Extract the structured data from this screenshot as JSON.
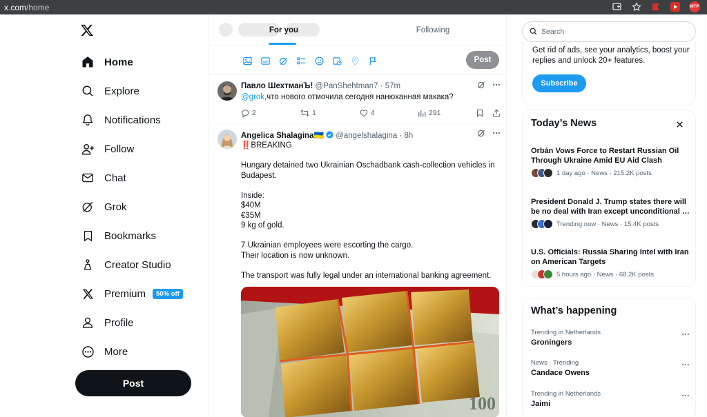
{
  "browser": {
    "url_host": "x.com",
    "url_path": "/home",
    "extension_1_label": "",
    "extension_2_label": "MTP"
  },
  "nav": {
    "items": [
      {
        "label": "Home",
        "icon": "home-icon"
      },
      {
        "label": "Explore",
        "icon": "search-icon"
      },
      {
        "label": "Notifications",
        "icon": "bell-icon"
      },
      {
        "label": "Follow",
        "icon": "follow-icon"
      },
      {
        "label": "Chat",
        "icon": "mail-icon"
      },
      {
        "label": "Grok",
        "icon": "grok-icon"
      },
      {
        "label": "Bookmarks",
        "icon": "bookmark-icon"
      },
      {
        "label": "Creator Studio",
        "icon": "creator-studio-icon"
      },
      {
        "label": "Premium",
        "icon": "x-logo-icon",
        "badge": "50% off"
      },
      {
        "label": "Profile",
        "icon": "profile-icon"
      },
      {
        "label": "More",
        "icon": "more-circle-icon"
      }
    ],
    "post_label": "Post"
  },
  "timeline": {
    "tabs": [
      "For you",
      "Following"
    ],
    "composer_post_label": "Post"
  },
  "tweet1": {
    "name": "Павло ШехтманЪ!",
    "handle": "@PanShehtman7",
    "time": "· 57m",
    "mention": "@grok",
    "text": ",что нового отмочила сегодня нанюханная макака?",
    "replies": "2",
    "reposts": "1",
    "likes": "4",
    "views": "291"
  },
  "tweet2": {
    "name": "Angelica Shalagina🇺🇦",
    "handle": "@angelshalagina",
    "time": "· 8h",
    "line1": "‼️BREAKING",
    "line2": "Hungary detained two Ukrainian Oschadbank cash-collection vehicles in",
    "line3": "Budapest.",
    "inside_label": "Inside:",
    "inside_1": "$40M",
    "inside_2": "€35M",
    "inside_3": "9 kg of gold.",
    "line4": "7 Ukrainian employees were escorting the cargo.",
    "line5": "Their location is now unknown.",
    "line6": "The transport was fully legal under an international banking agreement."
  },
  "right": {
    "search_placeholder": "Search",
    "premium_text": "Get rid of ads, see your analytics, boost your replies and unlock 20+ features.",
    "subscribe_label": "Subscribe",
    "news_title": "Today’s News",
    "news": [
      {
        "headline": "Orbán Vows Force to Restart Russian Oil Through Ukraine Amid EU Aid Clash",
        "meta": "1 day ago · News · 215.2K posts"
      },
      {
        "headline": "President Donald J. Trump states there will be no deal with Iran except unconditional …",
        "meta": "Trending now · News · 15.4K posts"
      },
      {
        "headline": "U.S. Officials: Russia Sharing Intel with Iran on American Targets",
        "meta": "5 hours ago · News · 68.2K posts"
      }
    ],
    "happening_title": "What’s happening",
    "trends": [
      {
        "category": "Trending in Netherlands",
        "name": "Groningers"
      },
      {
        "category": "News · Trending",
        "name": "Candace Owens"
      },
      {
        "category": "Trending in Netherlands",
        "name": "Jaimi"
      }
    ]
  },
  "colors": {
    "accent": "#1d9bf0",
    "text": "#0f1419",
    "muted": "#536471",
    "border": "#eff3f4"
  }
}
